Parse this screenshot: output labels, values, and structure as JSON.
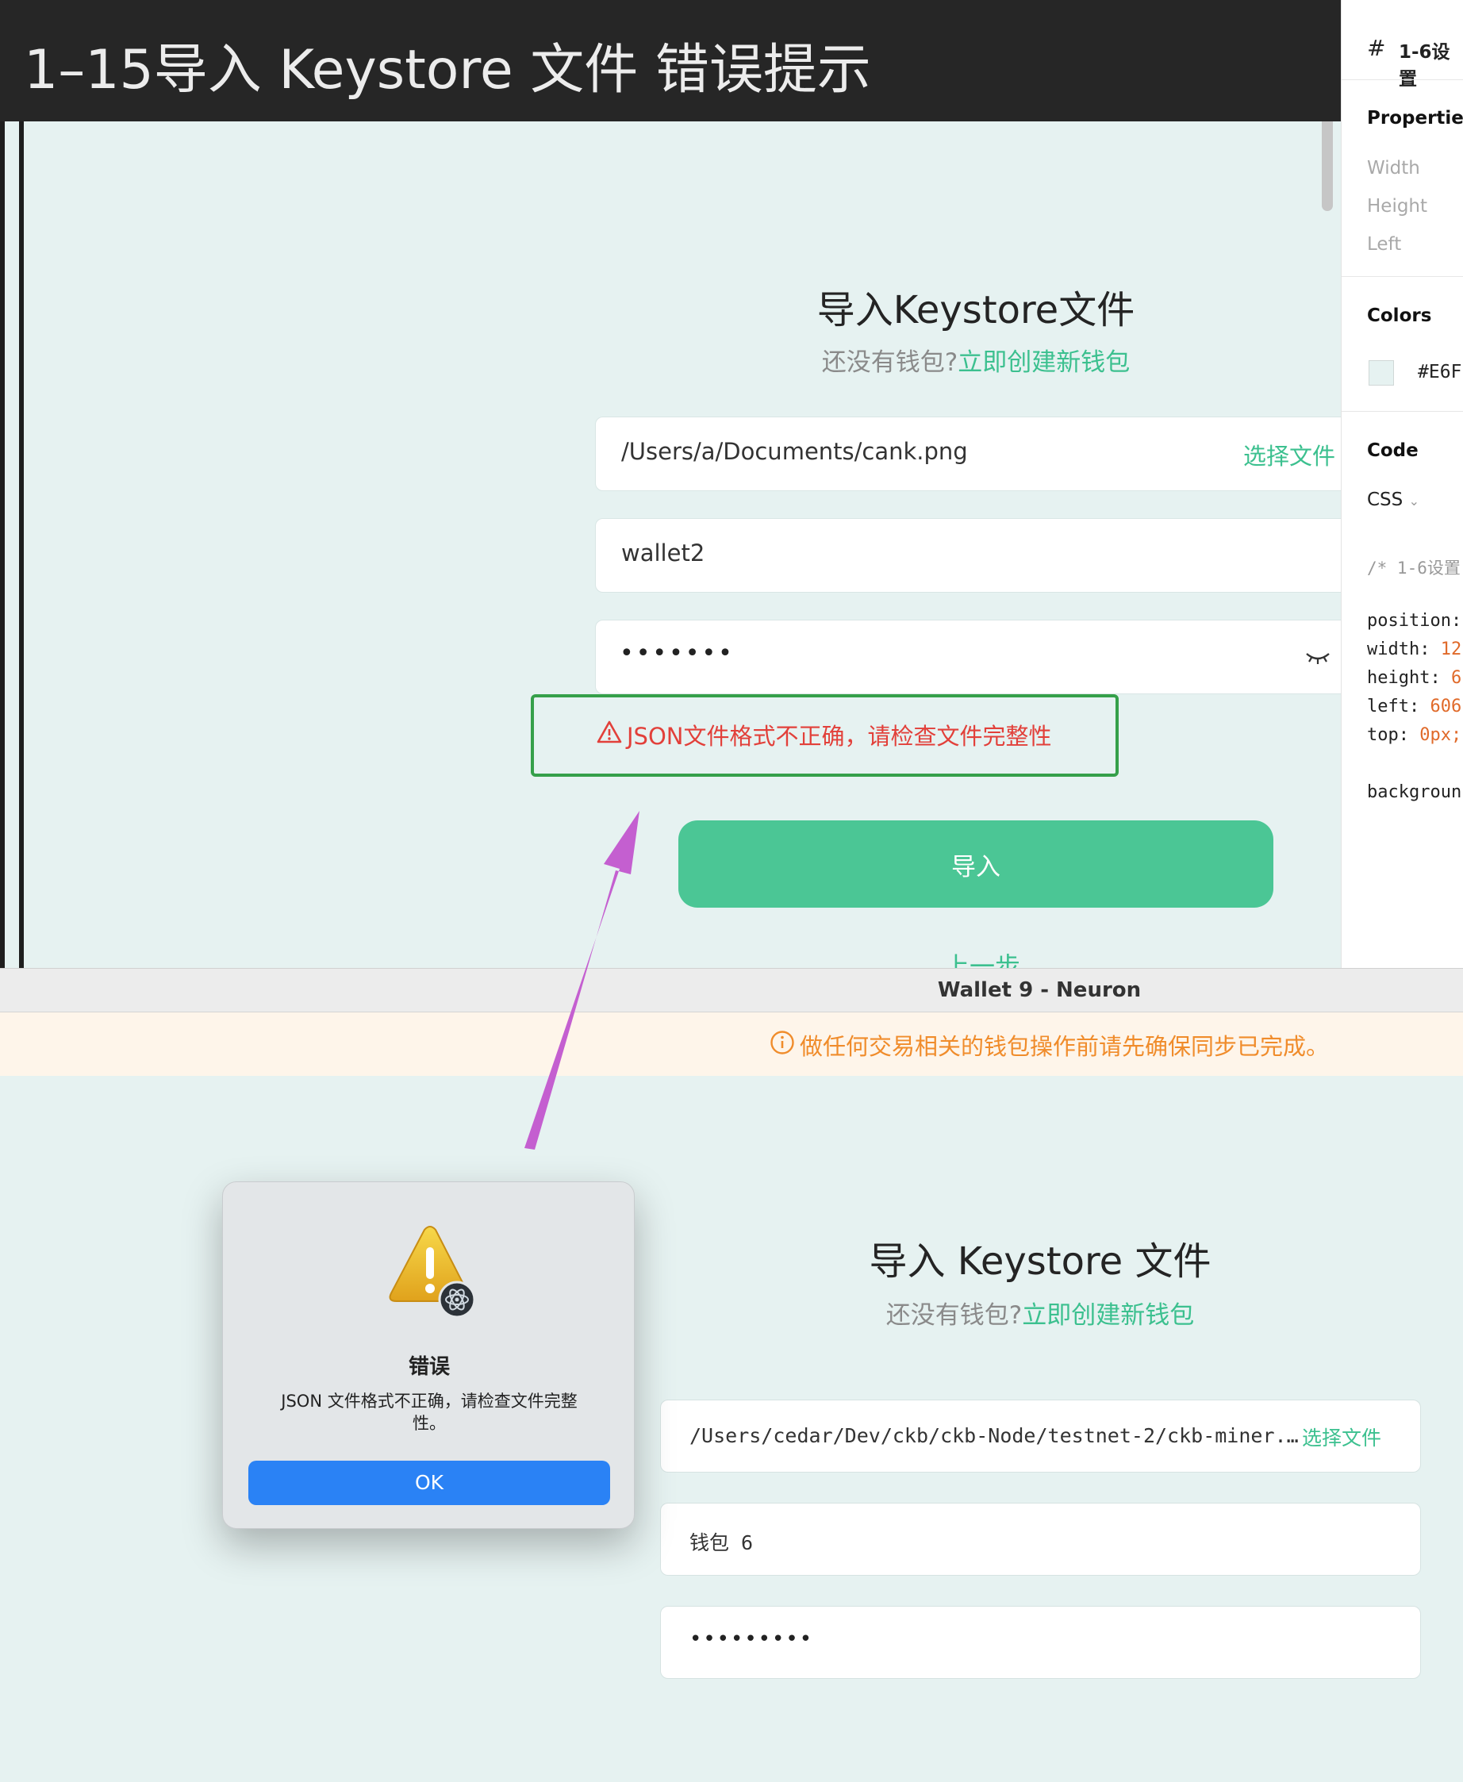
{
  "header": {
    "title": "1–15导入 Keystore 文件 错误提示"
  },
  "design": {
    "title": "导入Keystore文件",
    "subtitle_prefix": "还没有钱包?",
    "subtitle_link": "立即创建新钱包",
    "file_path": "/Users/a/Documents/cank.png",
    "choose_file": "选择文件",
    "wallet_name": "wallet2",
    "password_mask": "•••••••",
    "error_message": "JSON文件格式不正确，请检查文件完整性",
    "import_button": "导入",
    "back_link": "上一步"
  },
  "inspector": {
    "frame_name": "1-6设置",
    "properties_heading": "Properties",
    "width_label": "Width",
    "height_label": "Height",
    "left_label": "Left",
    "colors_heading": "Colors",
    "color_hex": "#E6F",
    "code_heading": "Code",
    "code_lang": "CSS",
    "code_comment": "/* 1-6设置",
    "code_lines": [
      {
        "prop": "position:",
        "val": ""
      },
      {
        "prop": "width:",
        "val": "12"
      },
      {
        "prop": "height:",
        "val": "6"
      },
      {
        "prop": "left:",
        "val": "606"
      },
      {
        "prop": "top:",
        "val": "0px;"
      }
    ],
    "code_bg": "backgroun"
  },
  "app": {
    "window_title": "Wallet 9 - Neuron",
    "sync_banner": "做任何交易相关的钱包操作前请先确保同步已完成。",
    "title": "导入 Keystore 文件",
    "subtitle_prefix": "还没有钱包?",
    "subtitle_link": "立即创建新钱包",
    "file_path": "/Users/cedar/Dev/ckb/ckb-Node/testnet-2/ckb-miner.…",
    "choose_file": "选择文件",
    "wallet_name": "钱包 6",
    "password_mask": "•••••••••"
  },
  "dialog": {
    "title": "错误",
    "message": "JSON 文件格式不正确，请检查文件完整性。",
    "ok_label": "OK"
  },
  "colors": {
    "accent": "#4bc695",
    "link": "#3cc08f",
    "error": "#e2403a",
    "warning": "#f08c2b",
    "annotation": "#c45fd0",
    "highlight_border": "#35a04a",
    "background": "#E6F2F1"
  }
}
